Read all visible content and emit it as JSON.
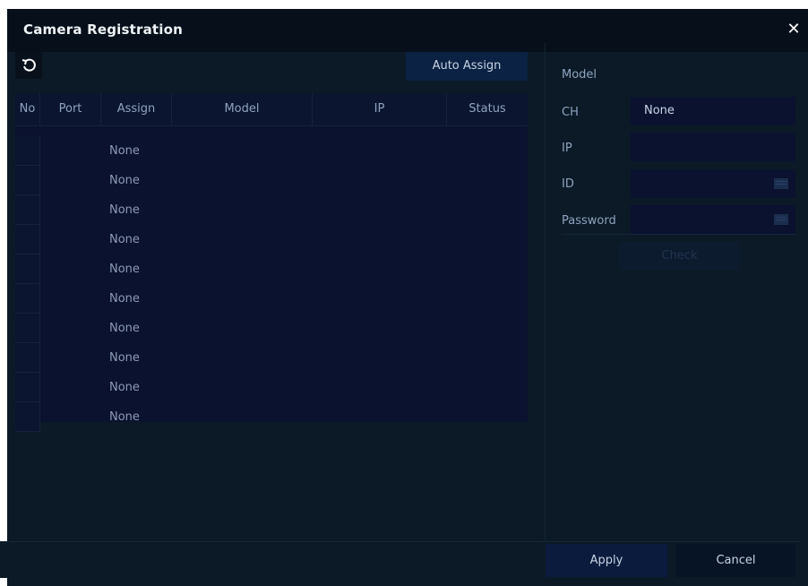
{
  "dialog": {
    "title": "Camera Registration",
    "close_icon": "close-icon"
  },
  "toolbar": {
    "refresh_icon": "refresh-icon",
    "auto_assign_label": "Auto Assign"
  },
  "table": {
    "columns": [
      "No",
      "Port",
      "Assign",
      "Model",
      "IP",
      "Status"
    ],
    "rows": [
      {
        "no": "",
        "port": "",
        "assign": "None",
        "model": "",
        "ip": "",
        "status": ""
      },
      {
        "no": "",
        "port": "",
        "assign": "None",
        "model": "",
        "ip": "",
        "status": ""
      },
      {
        "no": "",
        "port": "",
        "assign": "None",
        "model": "",
        "ip": "",
        "status": ""
      },
      {
        "no": "",
        "port": "",
        "assign": "None",
        "model": "",
        "ip": "",
        "status": ""
      },
      {
        "no": "",
        "port": "",
        "assign": "None",
        "model": "",
        "ip": "",
        "status": ""
      },
      {
        "no": "",
        "port": "",
        "assign": "None",
        "model": "",
        "ip": "",
        "status": ""
      },
      {
        "no": "",
        "port": "",
        "assign": "None",
        "model": "",
        "ip": "",
        "status": ""
      },
      {
        "no": "",
        "port": "",
        "assign": "None",
        "model": "",
        "ip": "",
        "status": ""
      },
      {
        "no": "",
        "port": "",
        "assign": "None",
        "model": "",
        "ip": "",
        "status": ""
      },
      {
        "no": "",
        "port": "",
        "assign": "None",
        "model": "",
        "ip": "",
        "status": ""
      }
    ]
  },
  "details": {
    "model_label": "Model",
    "ch_label": "CH",
    "ch_value": "None",
    "ip_label": "IP",
    "ip_value": "",
    "id_label": "ID",
    "id_value": "",
    "password_label": "Password",
    "password_value": "",
    "keyboard_icon": "keyboard-icon",
    "check_label": "Check"
  },
  "footer": {
    "apply_label": "Apply",
    "cancel_label": "Cancel"
  },
  "colors": {
    "window_bg": "#0b1a26",
    "titlebar_bg": "#07101a",
    "table_bg": "#0a1230",
    "header_text": "#8fa3bf",
    "accent_button": "#0b2244"
  }
}
